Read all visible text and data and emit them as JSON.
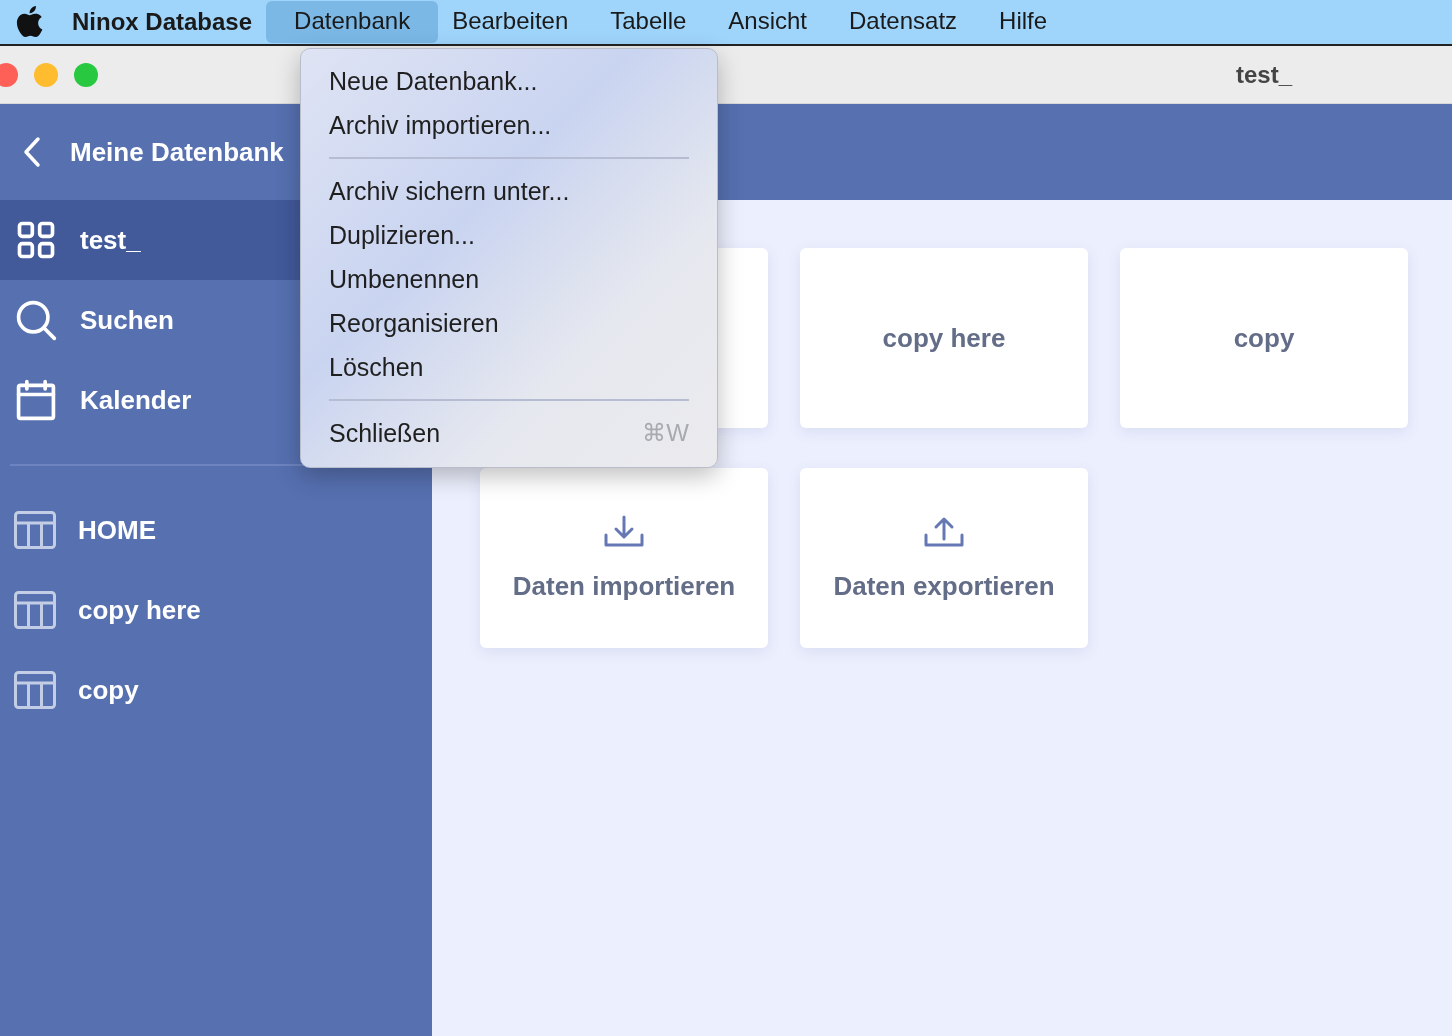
{
  "menu_bar": {
    "app_name": "Ninox Database",
    "items": [
      {
        "label": "Datenbank",
        "selected": true
      },
      {
        "label": "Bearbeiten",
        "selected": false
      },
      {
        "label": "Tabelle",
        "selected": false
      },
      {
        "label": "Ansicht",
        "selected": false
      },
      {
        "label": "Datensatz",
        "selected": false
      },
      {
        "label": "Hilfe",
        "selected": false
      }
    ]
  },
  "window": {
    "title": "test_"
  },
  "sidebar": {
    "back_label": "Meine Datenbank",
    "nav_items": [
      {
        "label": "test_",
        "kind": "overview",
        "selected": true
      },
      {
        "label": "Suchen",
        "kind": "search",
        "selected": false
      },
      {
        "label": "Kalender",
        "kind": "calendar",
        "selected": false
      }
    ],
    "tables": [
      {
        "label": "HOME",
        "selected": false
      },
      {
        "label": "copy here",
        "selected": false
      },
      {
        "label": "copy",
        "selected": false
      }
    ]
  },
  "cards": [
    {
      "kind": "table"
    },
    {
      "kind": "table",
      "label": "copy here"
    },
    {
      "kind": "table",
      "label": "copy"
    },
    {
      "kind": "import",
      "label": "Daten importieren"
    },
    {
      "kind": "export",
      "label": "Daten exportieren"
    }
  ],
  "dropdown_menu": {
    "items": [
      {
        "kind": "item",
        "label": "Neue Datenbank..."
      },
      {
        "kind": "item",
        "label": "Archiv importieren..."
      },
      {
        "kind": "separator"
      },
      {
        "kind": "item",
        "label": "Archiv sichern unter..."
      },
      {
        "kind": "item",
        "label": "Duplizieren..."
      },
      {
        "kind": "item",
        "label": "Umbenennen"
      },
      {
        "kind": "item",
        "label": "Reorganisieren"
      },
      {
        "kind": "item",
        "label": "Löschen"
      },
      {
        "kind": "separator"
      },
      {
        "kind": "item",
        "label": "Schließen",
        "shortcut": "⌘W"
      }
    ]
  }
}
